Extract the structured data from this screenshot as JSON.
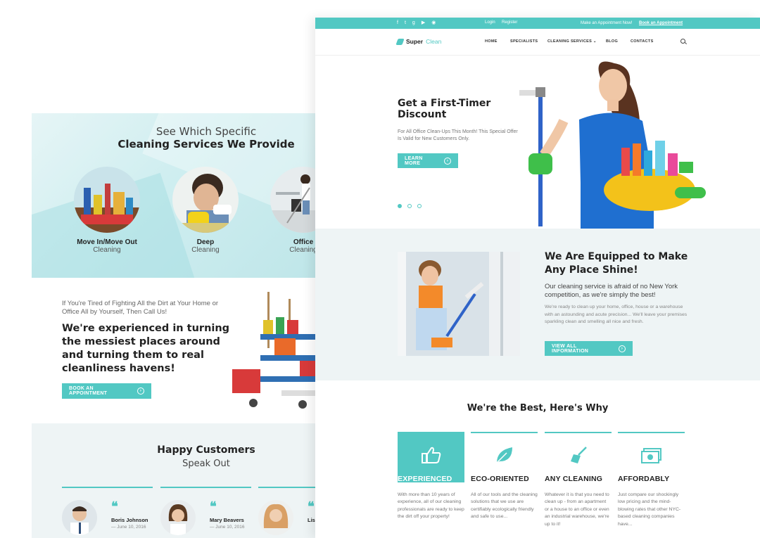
{
  "back": {
    "services": {
      "title_light": "See Which Specific",
      "title_bold": "Cleaning Services We Provide",
      "items": [
        {
          "name": "Move In/Move Out",
          "sub": "Cleaning"
        },
        {
          "name": "Deep",
          "sub": "Cleaning"
        },
        {
          "name": "Office",
          "sub": "Cleaning"
        }
      ]
    },
    "pitch": {
      "intro": "If You're Tired of Fighting All the Dirt at Your Home or Office All by Yourself, Then Call Us!",
      "heading": "We're experienced in turning the messiest places around and turning them to real cleanliness havens!",
      "button": "Book an Appointment"
    },
    "testimonials": {
      "title_bold": "Happy Customers",
      "title_light": "Speak Out",
      "items": [
        {
          "name": "Boris Johnson",
          "date": "— June 10, 2016"
        },
        {
          "name": "Mary Beavers",
          "date": "— June 10, 2016"
        },
        {
          "name": "Lis",
          "date": ""
        }
      ]
    }
  },
  "front": {
    "topbar": {
      "social_icons": [
        "facebook-icon",
        "twitter-icon",
        "google-plus-icon",
        "youtube-icon",
        "rss-icon"
      ],
      "login": "Login",
      "register": "Register",
      "appointment_text": "Make an Appointment Now!",
      "appointment_link": "Book an Appointment"
    },
    "nav": {
      "logo_bold": "Super",
      "logo_light": "Clean",
      "items": [
        "Home",
        "Specialists",
        "Cleaning Services",
        "Blog",
        "Contacts"
      ],
      "dropdown_indicator": "⌄"
    },
    "hero": {
      "title": "Get a First-Timer Discount",
      "desc": "For All Office Clean-Ups This Month! This Special Offer Is Valid for New Customers Only.",
      "button": "Learn More",
      "slides": 3,
      "active_slide": 1
    },
    "equip": {
      "title": "We Are Equipped to Make Any Place Shine!",
      "subtitle": "Our cleaning service is afraid of no New York competition, as we're simply the best!",
      "desc": "We're ready to clean up your home, office, house or a warehouse with an astounding and acute precision... We'll leave your premises sparkling clean and smelling all nice and fresh.",
      "button": "View All Information"
    },
    "best": {
      "title": "We're the Best, Here's Why",
      "items": [
        {
          "icon": "thumbs-up-icon",
          "heading": "Experienced",
          "text": "With more than 10 years of experience, all of our cleaning professionals are ready to keep the dirt off your property!"
        },
        {
          "icon": "leaf-icon",
          "heading": "Eco-Oriented",
          "text": "All of our tools and the cleaning solutions that we use are certifiably ecologically friendly and safe to use..."
        },
        {
          "icon": "broom-icon",
          "heading": "Any Cleaning",
          "text": "Whatever it is that you need to clean up - from an apartment or a house to an office or even an industrial warehouse, we're up to it!"
        },
        {
          "icon": "money-icon",
          "heading": "Affordably",
          "text": "Just compare our shockingly low pricing and the mind-blowing rates that other NYC-based cleaning companies have..."
        }
      ]
    }
  },
  "colors": {
    "accent": "#52c8c3",
    "light_bg": "#eef4f5",
    "text_dark": "#222222"
  }
}
